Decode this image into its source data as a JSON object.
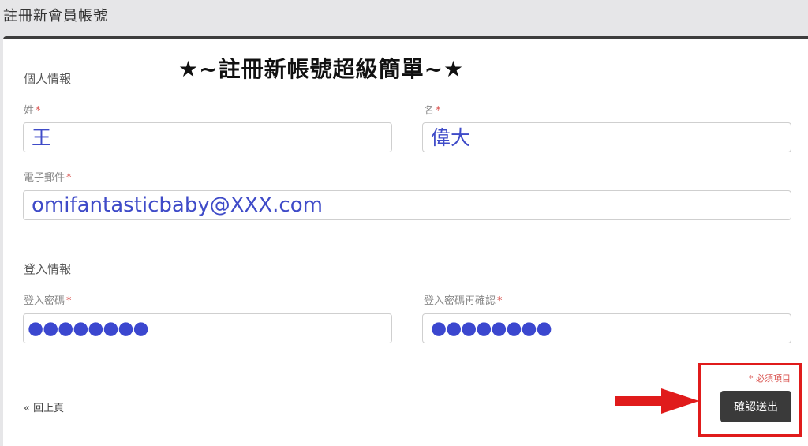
{
  "page": {
    "title": "註冊新會員帳號"
  },
  "banner": {
    "text": "★~註冊新帳號超級簡單~★"
  },
  "personal_section": {
    "title": "個人情報",
    "last_name": {
      "label": "姓",
      "required_mark": "*",
      "value": "王"
    },
    "first_name": {
      "label": "名",
      "required_mark": "*",
      "value": "偉大"
    },
    "email": {
      "label": "電子郵件",
      "required_mark": "*",
      "value": "omifantasticbaby@XXX.com"
    }
  },
  "login_section": {
    "title": "登入情報",
    "password": {
      "label": "登入密碼",
      "required_mark": "*",
      "value": "●●●●●●●●"
    },
    "password_confirm": {
      "label": "登入密碼再確認",
      "required_mark": "*",
      "value": "●●●●●●●●"
    }
  },
  "footer": {
    "back_link": "« 回上頁",
    "required_note": "* 必須項目",
    "submit_label": "確認送出"
  },
  "colors": {
    "accent_text": "#3f4bc8",
    "highlight": "#e01b1b",
    "button_bg": "#3a3a3a"
  }
}
